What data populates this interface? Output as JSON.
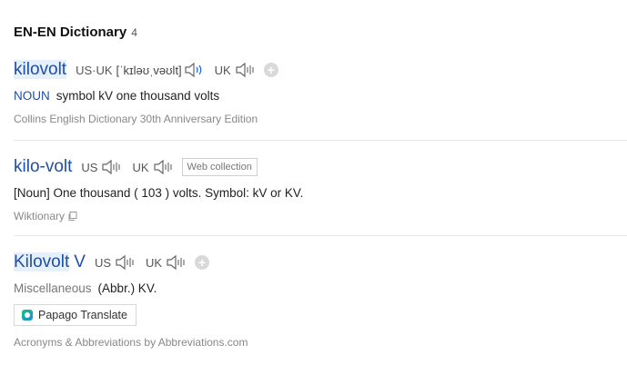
{
  "section": {
    "title": "EN-EN Dictionary",
    "count": "4"
  },
  "entries": [
    {
      "headword": "kilovolt",
      "pron_us_uk_label": "US·UK",
      "ipa": "[ˈkɪləʊˌvəʊlt]",
      "uk_label": "UK",
      "pos": "NOUN",
      "definition": "symbol kV one thousand volts",
      "source": "Collins English Dictionary 30th Anniversary Edition"
    },
    {
      "headword": "kilo-volt",
      "us_label": "US",
      "uk_label": "UK",
      "tag": "Web collection",
      "definition": "[Noun] One thousand ( 103 ) volts. Symbol: kV or KV.",
      "source": "Wiktionary"
    },
    {
      "headword": "Kilovolt",
      "headword_suffix": "V",
      "us_label": "US",
      "uk_label": "UK",
      "pos": "Miscellaneous",
      "definition": "(Abbr.) KV.",
      "papago_label": "Papago Translate",
      "source": "Acronyms & Abbreviations by Abbreviations.com"
    }
  ],
  "colors": {
    "headword": "#1e4ea8",
    "highlight": "#e6f0fb",
    "muted": "#888888"
  },
  "icons": [
    "speaker-icon",
    "plus-icon",
    "copy-icon",
    "papago-logo-icon"
  ]
}
